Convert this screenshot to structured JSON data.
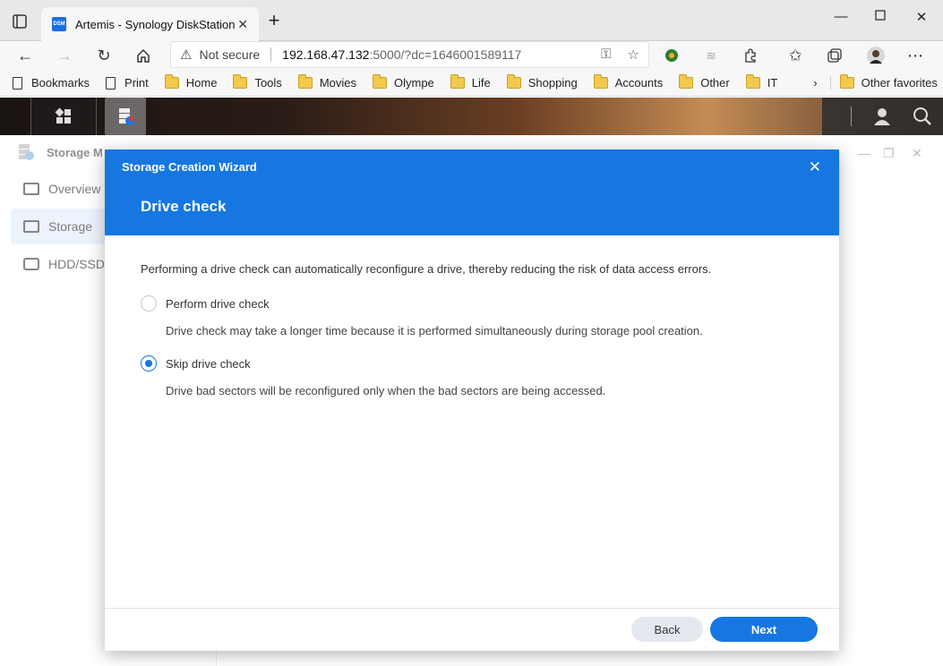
{
  "browser": {
    "tab_title": "Artemis - Synology DiskStation",
    "favicon_text": "DSM",
    "address": {
      "security_label": "Not secure",
      "host": "192.168.47.132",
      "path": ":5000/?dc=1646001589117"
    },
    "bookmarks": [
      {
        "label": "Bookmarks",
        "icon": "page-icon"
      },
      {
        "label": "Print",
        "icon": "page-icon"
      },
      {
        "label": "Home",
        "icon": "folder-icon"
      },
      {
        "label": "Tools",
        "icon": "folder-icon"
      },
      {
        "label": "Movies",
        "icon": "folder-icon"
      },
      {
        "label": "Olympe",
        "icon": "folder-icon"
      },
      {
        "label": "Life",
        "icon": "folder-icon"
      },
      {
        "label": "Shopping",
        "icon": "folder-icon"
      },
      {
        "label": "Accounts",
        "icon": "folder-icon"
      },
      {
        "label": "Other",
        "icon": "folder-icon"
      },
      {
        "label": "IT",
        "icon": "folder-icon"
      }
    ],
    "other_favorites": "Other favorites"
  },
  "app_window": {
    "title": "Storage M",
    "sidebar": [
      {
        "label": "Overview",
        "active": false
      },
      {
        "label": "Storage",
        "active": true
      },
      {
        "label": "HDD/SSD",
        "active": false
      }
    ]
  },
  "wizard": {
    "title": "Storage Creation Wizard",
    "step_title": "Drive check",
    "intro": "Performing a drive check can automatically reconfigure a drive, thereby reducing the risk of data access errors.",
    "options": [
      {
        "label": "Perform drive check",
        "description": "Drive check may take a longer time because it is performed simultaneously during storage pool creation.",
        "selected": false
      },
      {
        "label": "Skip drive check",
        "description": "Drive bad sectors will be reconfigured only when the bad sectors are being accessed.",
        "selected": true
      }
    ],
    "back_label": "Back",
    "next_label": "Next"
  },
  "colors": {
    "accent": "#1677e1"
  }
}
